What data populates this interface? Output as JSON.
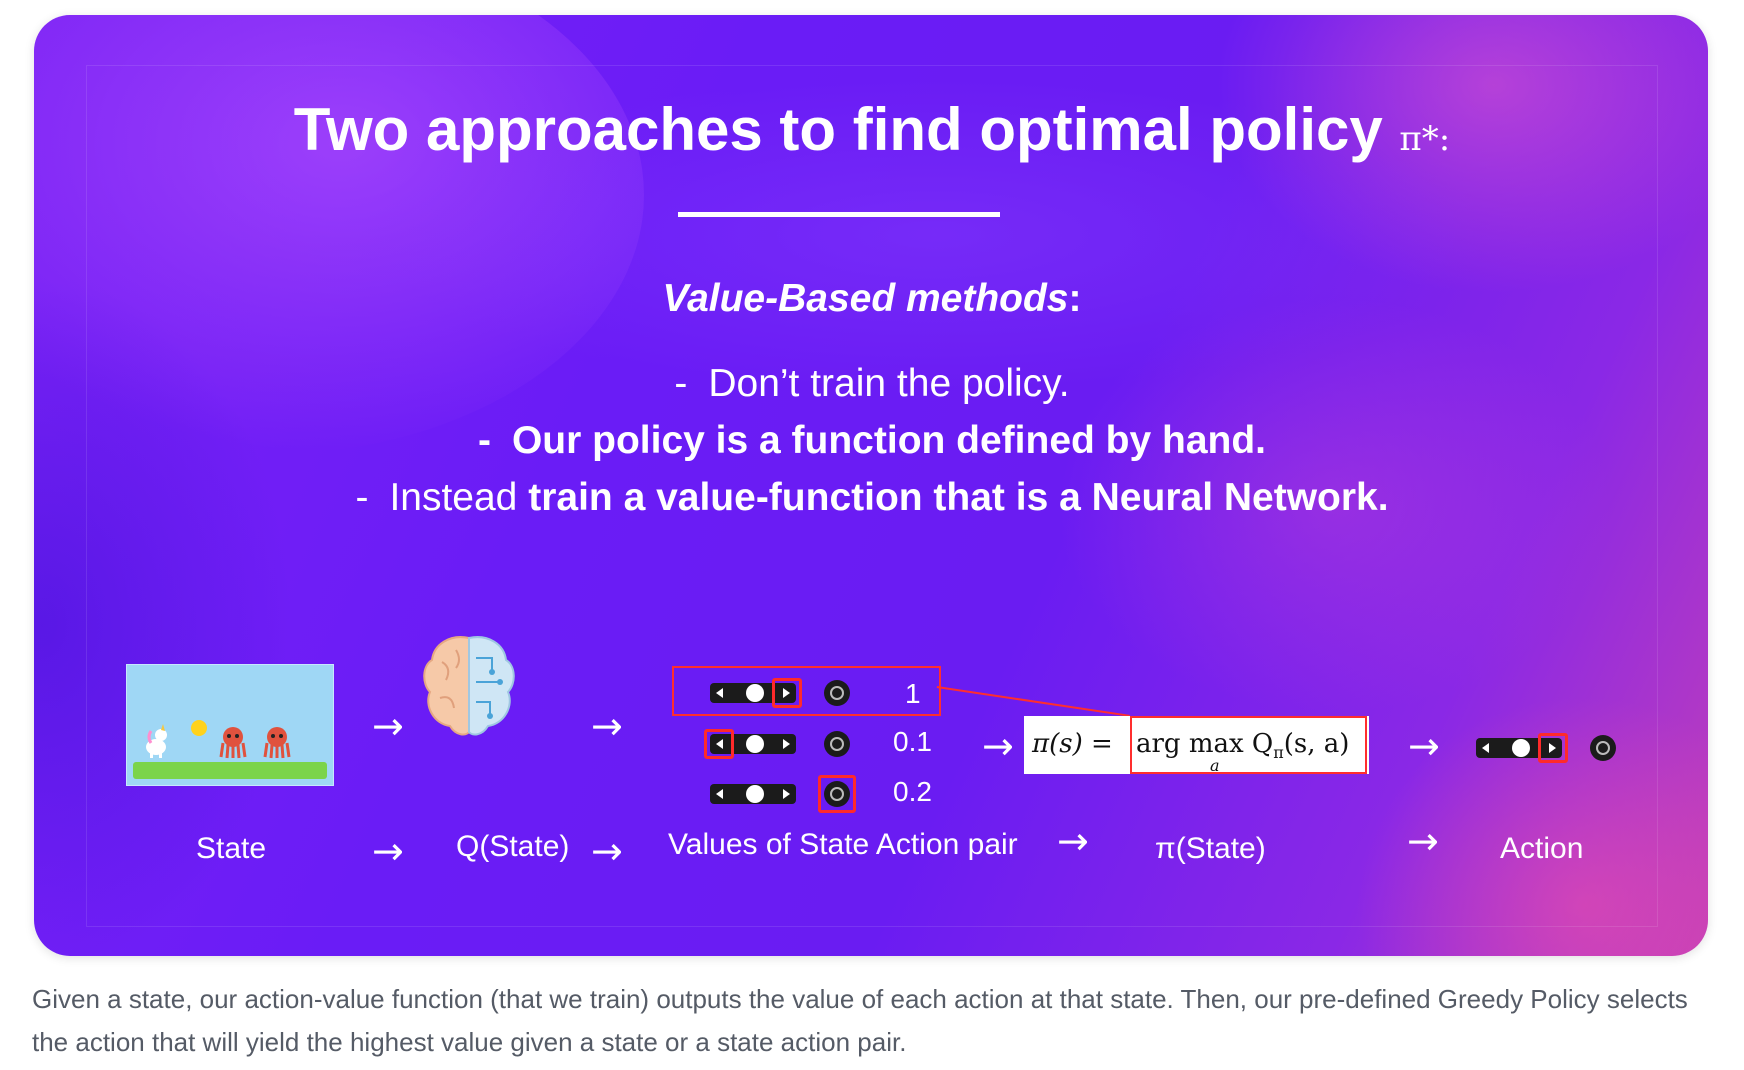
{
  "slide": {
    "title": "Two approaches to find optimal policy",
    "title_symbol": "π*:",
    "subtitle": "Value-Based methods",
    "subtitle_colon": ":",
    "bullets": [
      {
        "dash": "-",
        "text": "Don’t train the policy."
      },
      {
        "dash": "-",
        "text": "Our policy is a function defined by hand."
      },
      {
        "dash": "-",
        "normal": "Instead ",
        "bold": "train a value-function that is a Neural Network."
      }
    ],
    "arrow": "→",
    "values": [
      "1",
      "0.1",
      "0.2"
    ],
    "formula": {
      "lhs": "π(s) =",
      "rhs": "arg max Q",
      "rhs_sub": "π",
      "rhs_tail": "(s, a)",
      "under": "a"
    },
    "labels": {
      "state": "State",
      "qstate": "Q(State)",
      "values": "Values of State Action pair",
      "pistate": "π(State)",
      "action": "Action"
    }
  },
  "caption": "Given a state, our action-value function (that we train) outputs the value of each action at that state. Then, our pre-defined Greedy Policy selects the action that will yield the highest value given a state or a state action pair."
}
